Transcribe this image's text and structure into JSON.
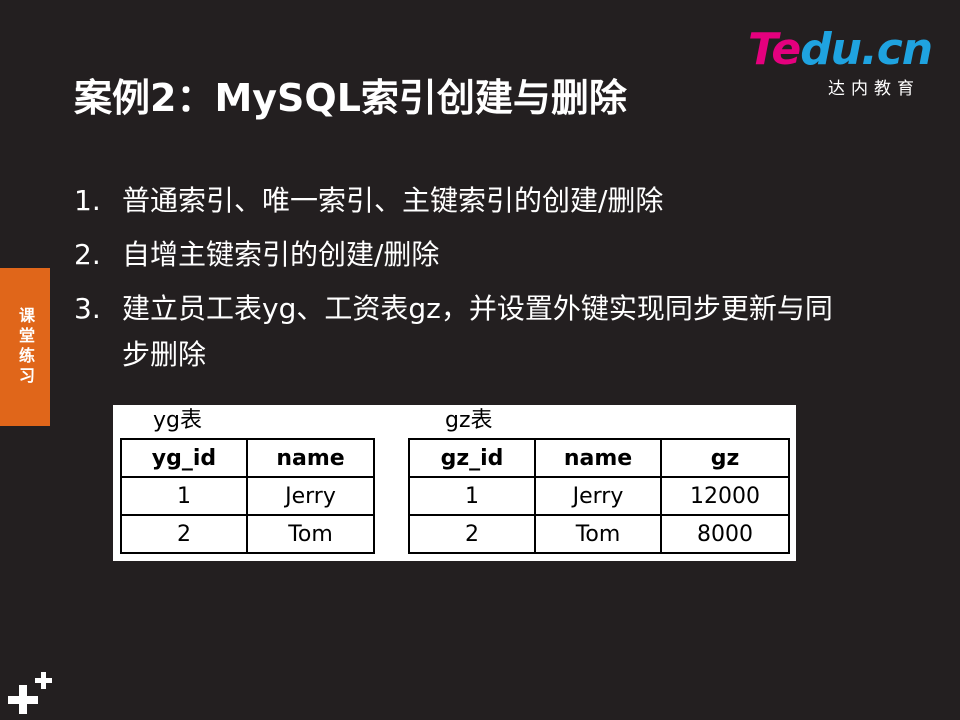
{
  "logo": {
    "main_part1": "Te",
    "main_part2": "du.cn",
    "sub": "达内教育",
    "colors": {
      "magenta": "#e5007e",
      "blue": "#1fa3e0"
    }
  },
  "slide": {
    "title": "案例2：MySQL索引创建与删除",
    "items": [
      {
        "num": "1.",
        "text": "普通索引、唯一索引、主键索引的创建/删除"
      },
      {
        "num": "2.",
        "text": "自增主键索引的创建/删除"
      },
      {
        "num": "3.",
        "text": "建立员工表yg、工资表gz，并设置外键实现同步更新与同步删除"
      }
    ]
  },
  "side_tab": {
    "label": "课堂练习",
    "color": "#e0661a"
  },
  "tables": {
    "yg": {
      "caption": "yg表",
      "headers": [
        "yg_id",
        "name"
      ],
      "rows": [
        [
          "1",
          "Jerry"
        ],
        [
          "2",
          "Tom"
        ]
      ]
    },
    "gz": {
      "caption": "gz表",
      "headers": [
        "gz_id",
        "name",
        "gz"
      ],
      "rows": [
        [
          "1",
          "Jerry",
          "12000"
        ],
        [
          "2",
          "Tom",
          "8000"
        ]
      ]
    }
  },
  "colors": {
    "background": "#231f20",
    "text": "#ffffff"
  },
  "icons": {
    "corner": "plus-logo-icon"
  }
}
